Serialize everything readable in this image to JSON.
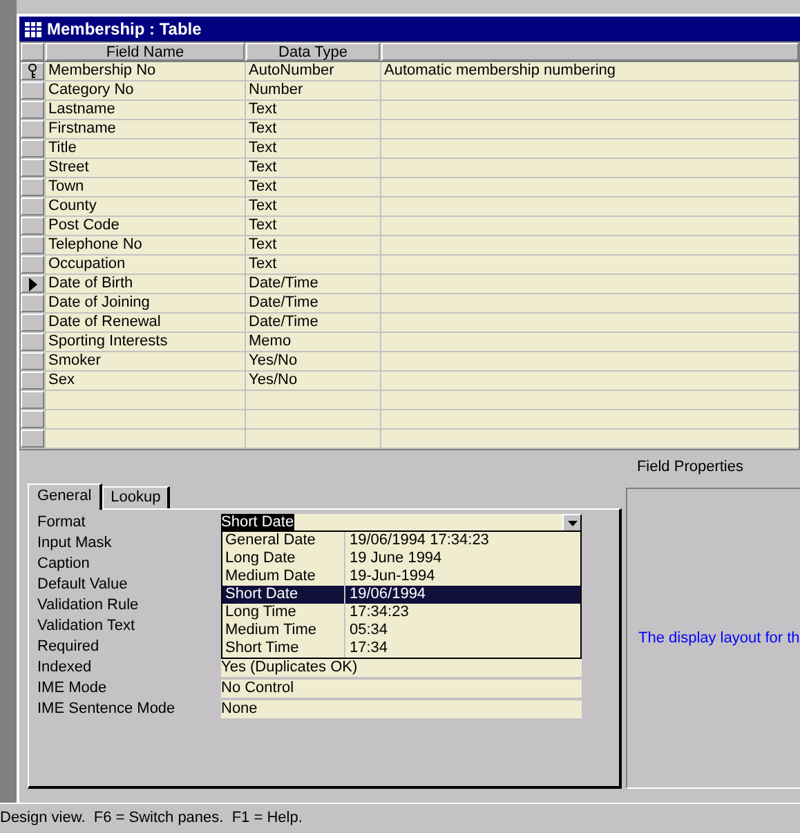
{
  "window": {
    "title": "Membership : Table"
  },
  "grid": {
    "columns": [
      "Field Name",
      "Data Type"
    ],
    "rows": [
      {
        "field": "Membership No",
        "type": "AutoNumber",
        "description": "Automatic membership numbering",
        "primary_key": true,
        "current": false
      },
      {
        "field": "Category No",
        "type": "Number",
        "primary_key": false,
        "current": false
      },
      {
        "field": "Lastname",
        "type": "Text",
        "primary_key": false,
        "current": false
      },
      {
        "field": "Firstname",
        "type": "Text",
        "primary_key": false,
        "current": false
      },
      {
        "field": "Title",
        "type": "Text",
        "primary_key": false,
        "current": false
      },
      {
        "field": "Street",
        "type": "Text",
        "primary_key": false,
        "current": false
      },
      {
        "field": "Town",
        "type": "Text",
        "primary_key": false,
        "current": false
      },
      {
        "field": "County",
        "type": "Text",
        "primary_key": false,
        "current": false
      },
      {
        "field": "Post Code",
        "type": "Text",
        "primary_key": false,
        "current": false
      },
      {
        "field": "Telephone No",
        "type": "Text",
        "primary_key": false,
        "current": false
      },
      {
        "field": "Occupation",
        "type": "Text",
        "primary_key": false,
        "current": false
      },
      {
        "field": "Date of Birth",
        "type": "Date/Time",
        "primary_key": false,
        "current": true
      },
      {
        "field": "Date of Joining",
        "type": "Date/Time",
        "primary_key": false,
        "current": false
      },
      {
        "field": "Date of Renewal",
        "type": "Date/Time",
        "primary_key": false,
        "current": false
      },
      {
        "field": "Sporting Interests",
        "type": "Memo",
        "primary_key": false,
        "current": false
      },
      {
        "field": "Smoker",
        "type": "Yes/No",
        "primary_key": false,
        "current": false
      },
      {
        "field": "Sex",
        "type": "Yes/No",
        "primary_key": false,
        "current": false
      },
      {
        "primary_key": false,
        "current": false
      },
      {
        "primary_key": false,
        "current": false
      },
      {
        "primary_key": false,
        "current": false
      }
    ]
  },
  "field_properties": {
    "heading": "Field Properties",
    "tabs": [
      {
        "label": "General",
        "selected": true
      },
      {
        "label": "Lookup",
        "selected": false
      }
    ],
    "properties": [
      {
        "label": "Format",
        "value": "Short Date",
        "kind": "dropdown"
      },
      {
        "label": "Input Mask",
        "kind": "hidden"
      },
      {
        "label": "Caption",
        "kind": "hidden"
      },
      {
        "label": "Default Value",
        "kind": "hidden"
      },
      {
        "label": "Validation Rule",
        "kind": "hidden"
      },
      {
        "label": "Validation Text",
        "kind": "hidden"
      },
      {
        "label": "Required",
        "kind": "hidden"
      },
      {
        "label": "Indexed",
        "value": "Yes (Duplicates OK)",
        "kind": "text"
      },
      {
        "label": "IME Mode",
        "value": "No Control",
        "kind": "text"
      },
      {
        "label": "IME Sentence Mode",
        "value": "None",
        "kind": "text"
      }
    ],
    "format_options": [
      {
        "name": "General Date",
        "example": "19/06/1994 17:34:23",
        "selected": false
      },
      {
        "name": "Long Date",
        "example": "19 June 1994",
        "selected": false
      },
      {
        "name": "Medium Date",
        "example": "19-Jun-1994",
        "selected": false
      },
      {
        "name": "Short Date",
        "example": "19/06/1994",
        "selected": true
      },
      {
        "name": "Long Time",
        "example": "17:34:23",
        "selected": false
      },
      {
        "name": "Medium Time",
        "example": "05:34",
        "selected": false
      },
      {
        "name": "Short Time",
        "example": "17:34",
        "selected": false
      }
    ],
    "help_text": "The display layout for th"
  },
  "status_bar": {
    "text": "Design view.  F6 = Switch panes.  F1 = Help."
  }
}
